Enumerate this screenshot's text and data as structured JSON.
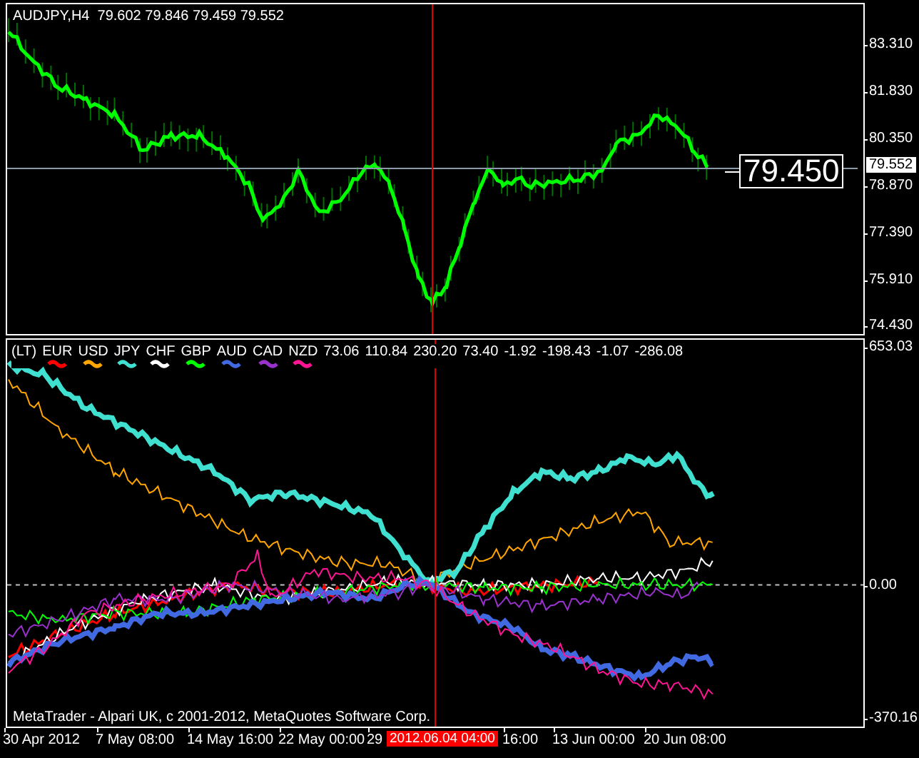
{
  "price_chart": {
    "header": "AUDJPY,H4  79.602 79.846 79.459 79.552",
    "price_axis": [
      "83.310",
      "81.830",
      "80.350",
      "78.870",
      "77.390",
      "75.910",
      "74.430"
    ],
    "current_price": "79.552",
    "crosshair_price": "79.450"
  },
  "indicator": {
    "label": "(LT)",
    "currencies": [
      {
        "name": "EUR",
        "color": "#ff0000"
      },
      {
        "name": "USD",
        "color": "#ffa500"
      },
      {
        "name": "JPY",
        "color": "#40e0d0"
      },
      {
        "name": "CHF",
        "color": "#ffffff"
      },
      {
        "name": "GBP",
        "color": "#00ff00"
      },
      {
        "name": "AUD",
        "color": "#4169e1"
      },
      {
        "name": "CAD",
        "color": "#9932cc"
      },
      {
        "name": "NZD",
        "color": "#ff1493"
      }
    ],
    "values": [
      "73.06",
      "110.84",
      "230.20",
      "73.40",
      "-1.92",
      "-198.43",
      "-1.07",
      "-286.08"
    ],
    "axis": [
      "653.03",
      "0.00",
      "-370.16"
    ]
  },
  "copyright": "MetaTrader - Alpari UK, c 2001-2012, MetaQuotes Software Corp.",
  "time_axis": {
    "labels": [
      "30 Apr 2012",
      "7 May 08:00",
      "14 May 16:00",
      "22 May 00:00",
      "29",
      "16:00",
      "13 Jun 00:00",
      "20 Jun 08:00"
    ],
    "crosshair_time": "2012.06.04 04:00"
  }
}
